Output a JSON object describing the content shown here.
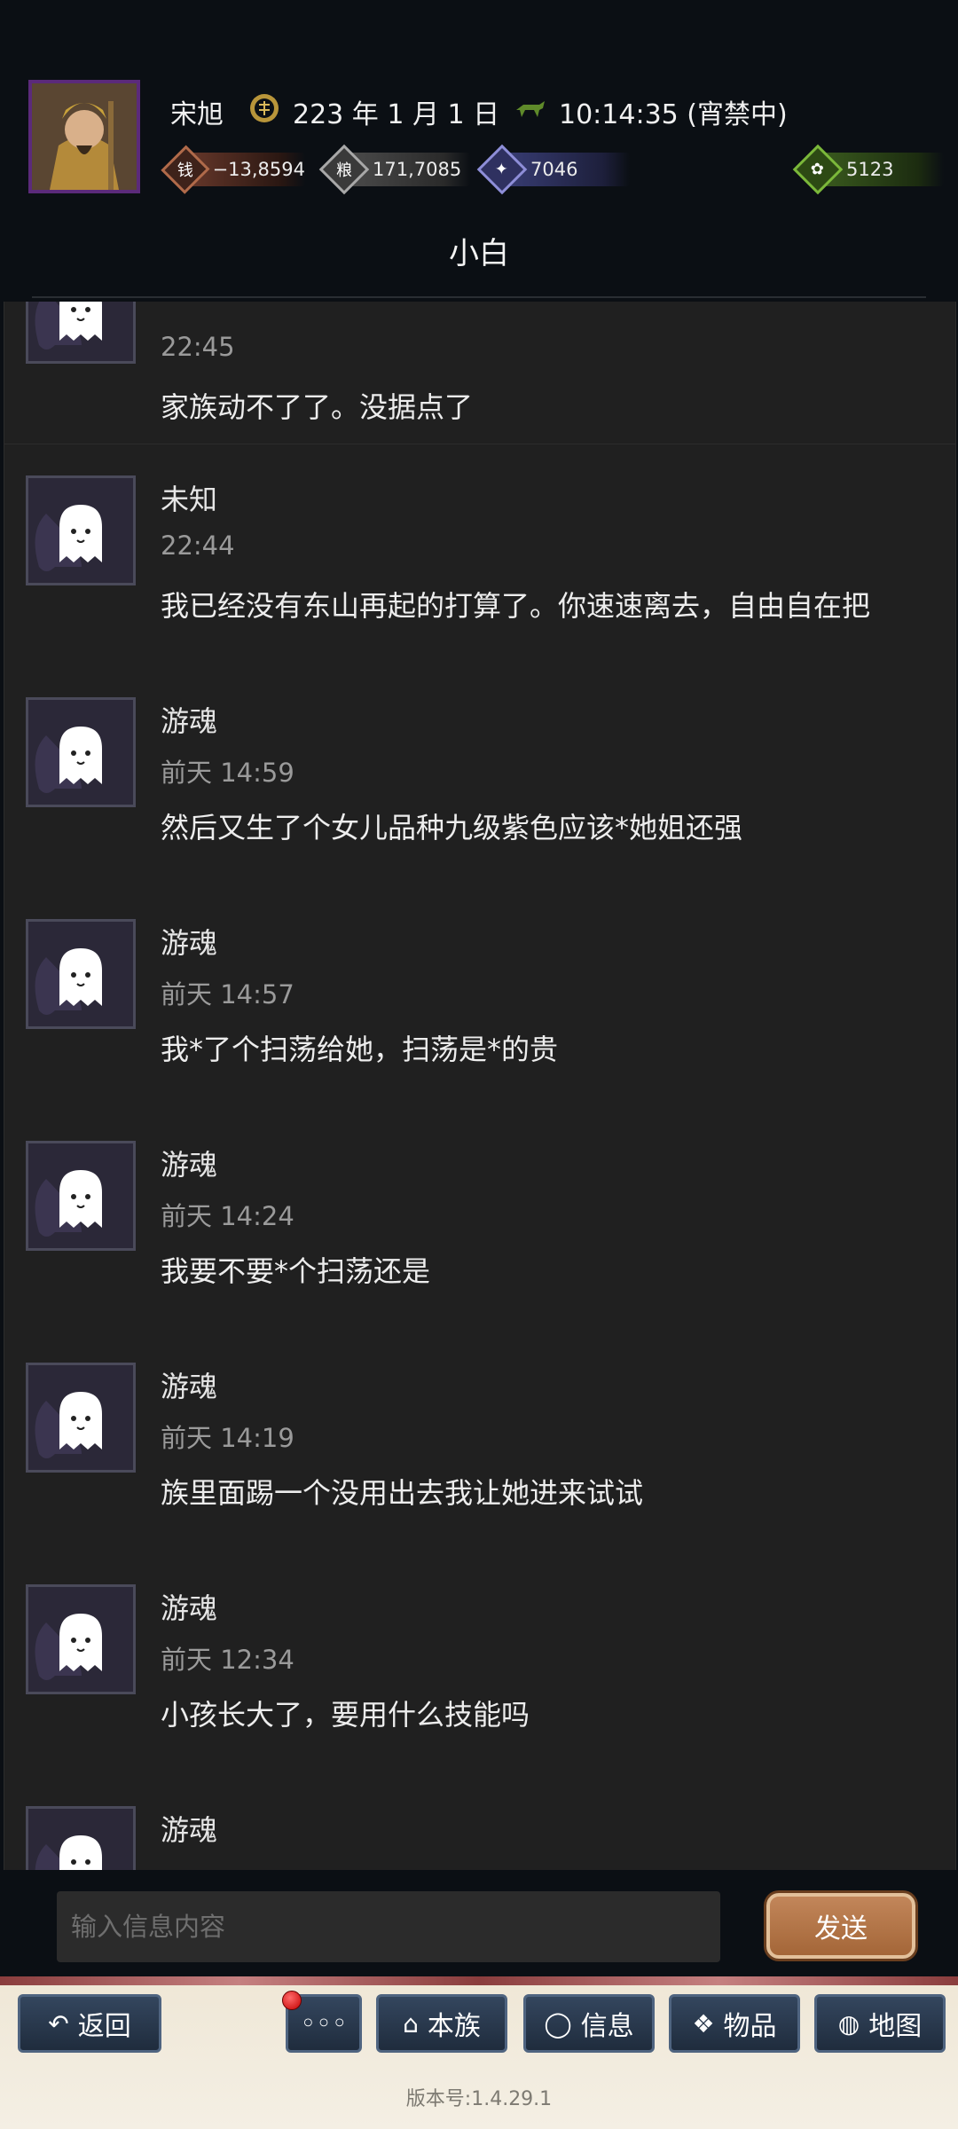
{
  "header": {
    "player_name": "宋旭",
    "date": "223 年 1 月 1 日",
    "time": "10:14:35 (宵禁中)",
    "resources": [
      {
        "icon": "money-icon",
        "value": "−13,8594"
      },
      {
        "icon": "grain-icon",
        "value": "171,7085"
      },
      {
        "icon": "strength-icon",
        "value": "7046"
      },
      {
        "icon": "bag-icon",
        "value": "5123"
      }
    ],
    "chat_title": "小白"
  },
  "messages": [
    {
      "sender": "",
      "time": "22:45",
      "text": "家族动不了了。没据点了"
    },
    {
      "sender": "未知",
      "time": "22:44",
      "text": "我已经没有东山再起的打算了。你速速离去，自由自在把"
    },
    {
      "sender": "游魂",
      "time": "前天 14:59",
      "text": "然后又生了个女儿品种九级紫色应该*她姐还强"
    },
    {
      "sender": "游魂",
      "time": "前天 14:57",
      "text": "我*了个扫荡给她，扫荡是*的贵"
    },
    {
      "sender": "游魂",
      "time": "前天 14:24",
      "text": "我要不要*个扫荡还是"
    },
    {
      "sender": "游魂",
      "time": "前天 14:19",
      "text": "族里面踢一个没用出去我让她进来试试"
    },
    {
      "sender": "游魂",
      "time": "前天 12:34",
      "text": "小孩长大了，要用什么技能吗"
    },
    {
      "sender": "游魂",
      "time": "",
      "text": ""
    }
  ],
  "input": {
    "placeholder": "输入信息内容",
    "send_label": "发送"
  },
  "nav": {
    "back": "返回",
    "more": "◦◦◦",
    "clan": "本族",
    "info": "信息",
    "items": "物品",
    "map": "地图"
  },
  "version": "版本号:1.4.29.1"
}
